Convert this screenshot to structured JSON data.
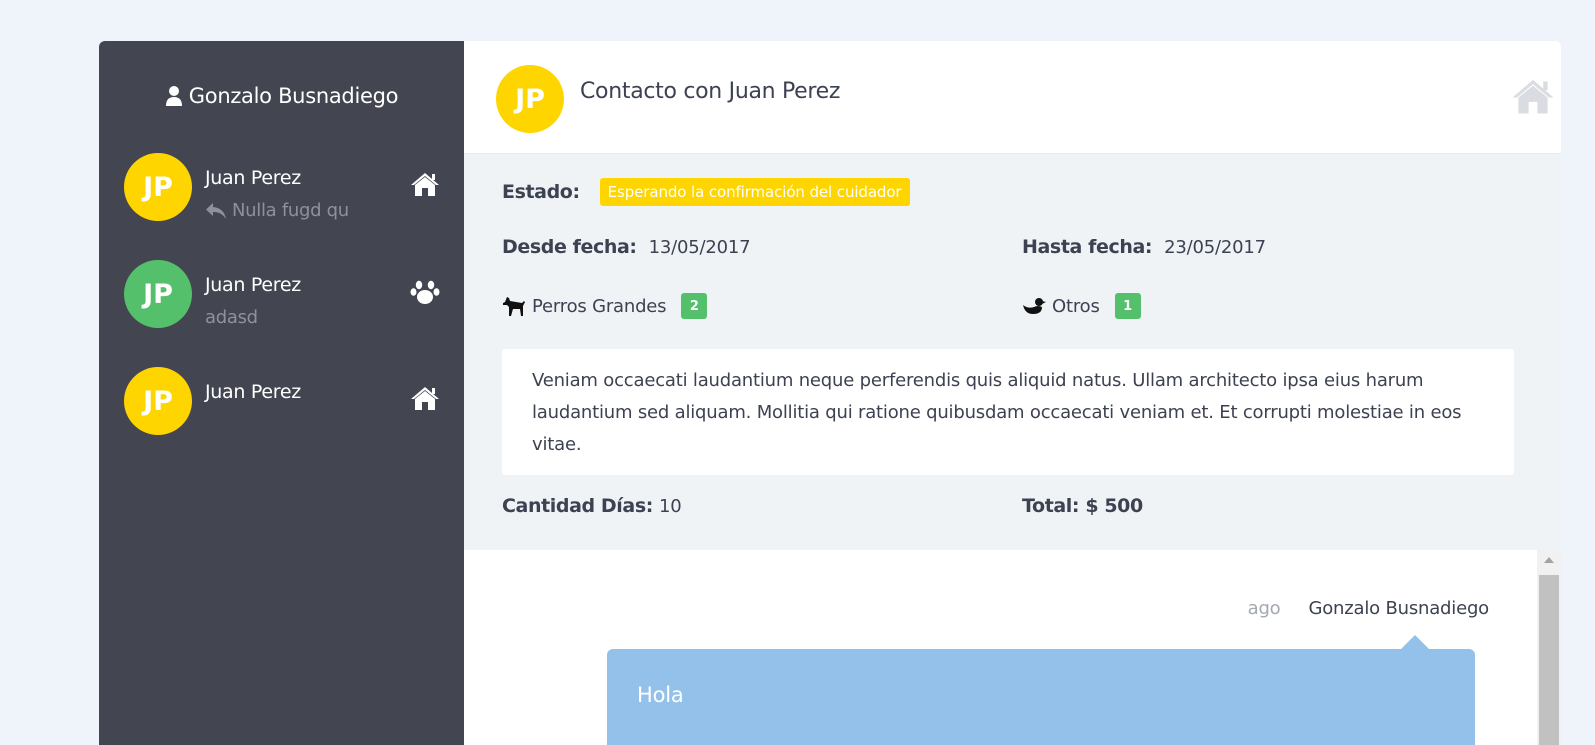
{
  "colors": {
    "sidebar_bg": "#434651",
    "avatar_yellow": "#ffd500",
    "avatar_green": "#55c06b",
    "status_badge": "#ffd500",
    "count_badge": "#55c06b",
    "chat_bubble": "#94c1ea"
  },
  "sidebar": {
    "user_name": "Gonzalo Busnadiego",
    "user_icon": "user-icon",
    "contacts": [
      {
        "initials": "JP",
        "name": "Juan Perez",
        "subtitle": "Nulla fugd qu",
        "subtitle_icon": "reply-icon",
        "type_icon": "home-icon",
        "avatar_color": "#ffd500"
      },
      {
        "initials": "JP",
        "name": "Juan Perez",
        "subtitle": "adasd",
        "type_icon": "paw-icon",
        "avatar_color": "#55c06b"
      },
      {
        "initials": "JP",
        "name": "Juan Perez",
        "subtitle": "",
        "type_icon": "home-icon",
        "avatar_color": "#ffd500"
      }
    ]
  },
  "header": {
    "initials": "JP",
    "title": "Contacto con Juan Perez",
    "right_icon": "home-icon"
  },
  "details": {
    "estado_label": "Estado:",
    "estado_value": "Esperando la confirmación del cuidador",
    "desde_label": "Desde fecha:",
    "desde_value": "13/05/2017",
    "hasta_label": "Hasta fecha:",
    "hasta_value": "23/05/2017",
    "pets": [
      {
        "icon": "dog-icon",
        "label": "Perros Grandes",
        "count": "2"
      },
      {
        "icon": "duck-icon",
        "label": "Otros",
        "count": "1"
      }
    ],
    "description": "Veniam occaecati laudantium neque perferendis quis aliquid natus. Ullam architecto ipsa eius harum laudantium sed aliquam. Mollitia qui ratione quibusdam occaecati veniam et. Et corrupti molestiae in eos vitae.",
    "dias_label": "Cantidad Días:",
    "dias_value": "10",
    "total_label": "Total: $ 500"
  },
  "chat": {
    "messages": [
      {
        "time": "ago",
        "author": "Gonzalo Busnadiego",
        "text": "Hola"
      }
    ]
  }
}
